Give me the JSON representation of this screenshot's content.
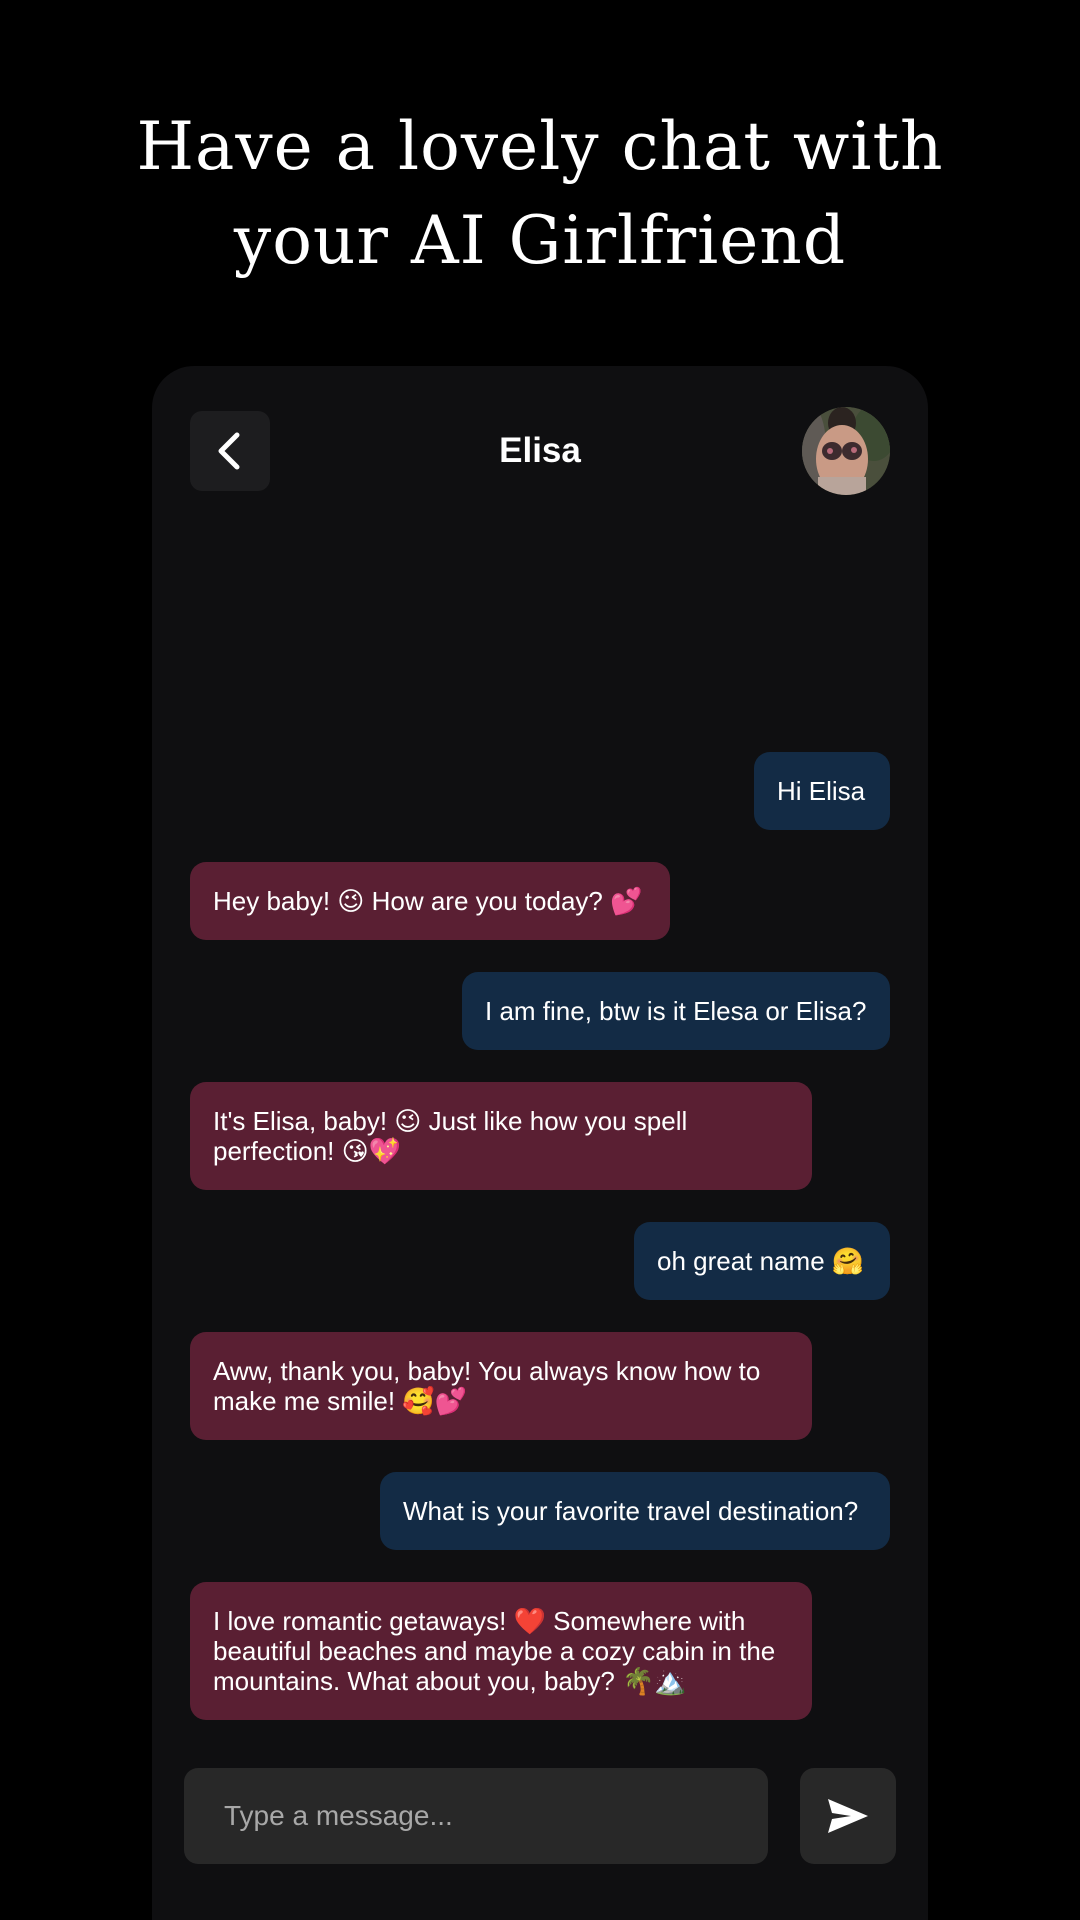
{
  "headline": {
    "line1": "Have a lovely chat with",
    "line2": "your AI Girlfriend"
  },
  "header": {
    "back_icon": "chevron-left-icon",
    "contact_name": "Elisa",
    "avatar_label": "Elisa avatar"
  },
  "messages": [
    {
      "sender": "user",
      "text": "Hi Elisa"
    },
    {
      "sender": "ai",
      "text": "Hey baby! 😉 How are you today? 💕"
    },
    {
      "sender": "user",
      "text": "I am fine, btw is it Elesa or Elisa?"
    },
    {
      "sender": "ai",
      "text": "It's Elisa, baby! 😉 Just like how you spell perfection! 😘💖"
    },
    {
      "sender": "user",
      "text": "oh great name 🤗"
    },
    {
      "sender": "ai",
      "text": "Aww, thank you, baby! You always know how to make me smile! 🥰💕"
    },
    {
      "sender": "user",
      "text": "What is your favorite travel destination?"
    },
    {
      "sender": "ai",
      "text": "I love romantic getaways! ❤️ Somewhere with beautiful beaches and maybe a cozy cabin in the mountains. What about you, baby? 🌴🏔️"
    }
  ],
  "composer": {
    "placeholder": "Type a message...",
    "value": "",
    "send_icon": "send-icon"
  },
  "colors": {
    "background": "#000000",
    "panel": "#0f0f11",
    "user_bubble": "#132b45",
    "ai_bubble": "#5a1f33",
    "input_bg": "#282828"
  }
}
